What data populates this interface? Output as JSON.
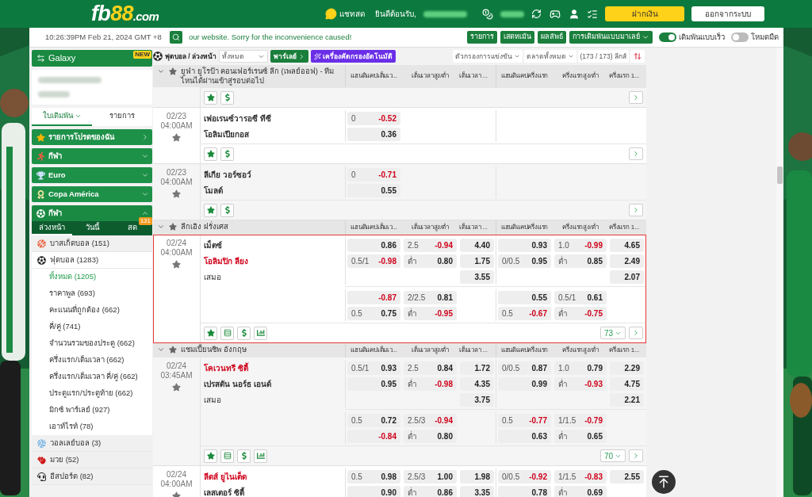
{
  "header": {
    "logo": {
      "brand": "fb",
      "digits": "88",
      "domain": ".com"
    },
    "chat": "แชทสด",
    "welcome": "ยินดีต้อนรับ,",
    "deposit": "ฝากเงิน",
    "logout": "ออกจากระบบ"
  },
  "topbar": {
    "clock": "10:26:39PM Feb 21, 2024 GMT +8",
    "marquee": "our website. Sorry for the inconvenience caused!",
    "buttons": [
      "รายการ",
      "เสตทเม้น",
      "ผลลัพธ์"
    ],
    "odds_type": "การเดิมพันแบบมาเลย์",
    "toggles": [
      {
        "label": "เดิมพันแบบเร็ว",
        "on": true
      },
      {
        "label": "โหมดมืด",
        "on": false
      }
    ]
  },
  "sidebar": {
    "banner": {
      "label": "Galaxy",
      "ribbon": "NEW"
    },
    "tabs": [
      {
        "label": "ใบเดิมพัน",
        "selected": true
      },
      {
        "label": "รายการ",
        "selected": false
      }
    ],
    "sections": [
      {
        "label": "รายการโปรดของฉัน",
        "kind": "link"
      },
      {
        "label": "กีฬา",
        "kind": "accordion",
        "expanded": false
      },
      {
        "label": "Euro",
        "kind": "accordion",
        "expanded": false
      },
      {
        "label": "Copa América",
        "kind": "accordion",
        "expanded": false
      },
      {
        "label": "กีฬา",
        "kind": "accordion",
        "expanded": true
      }
    ],
    "sport_tabs": [
      {
        "label": "ล่วงหน้า",
        "selected": true
      },
      {
        "label": "วันนี้",
        "selected": false
      },
      {
        "label": "สด",
        "selected": false,
        "badge": "131"
      }
    ],
    "sports": [
      {
        "label": "บาสเก็ตบอล (151)",
        "expanded": false
      },
      {
        "label": "ฟุตบอล (1283)",
        "expanded": true,
        "children": [
          {
            "label": "ทั้งหมด (1205)",
            "selected": true
          },
          {
            "label": "ราคาพูล (693)",
            "selected": false
          },
          {
            "label": "คะแนนที่ถูกต้อง (662)",
            "selected": false
          },
          {
            "label": "คี่/คู่ (741)",
            "selected": false
          },
          {
            "label": "จำนวนรวมของประตู (662)",
            "selected": false
          },
          {
            "label": "ครึ่งแรก/เต็มเวลา (662)",
            "selected": false
          },
          {
            "label": "ครึ่งแรก/เต็มเวลา คี่/คู่ (662)",
            "selected": false
          },
          {
            "label": "ประตูแรก/ประตูท้าย (662)",
            "selected": false
          },
          {
            "label": "มิกซ์ พาร์เลย์ (927)",
            "selected": false
          },
          {
            "label": "เอาท์ไรท์ (78)",
            "selected": false
          }
        ]
      },
      {
        "label": "วอลเลย์บอล (3)",
        "expanded": false
      },
      {
        "label": "มวย (52)",
        "expanded": false
      },
      {
        "label": "อีสปอร์ต (82)",
        "expanded": false
      }
    ]
  },
  "toolbar": {
    "title": "ฟุตบอล / ล่วงหน้า",
    "filter": "ทั้งหมด",
    "parlay": "พาร์เลย์",
    "auto_filter": "เครื่องคัดกรองอัตโนมัติ",
    "dropdowns": [
      "ตัวกรองการแข่งขัน",
      "ตลาดทั้งหมด"
    ],
    "league_count": "(173 / 173) ลีกส์"
  },
  "leagues": [
    {
      "name": "ยูฟ่า ยูโรป้า คอนเฟอร์เรนซ์ ลีก (เพลย์ออฟ) - ทีมไหนได้ผ่านเข้าสู่รอบต่อไป",
      "expanded": true,
      "columns": [
        "แฮนดิแคปเต็มเว...",
        "เต็มเวลาสูง/ต่ำ",
        "เต็มเวลา ...",
        "แฮนดิแคปครึ่งแรก",
        "ครึ่งแรกสูง/ต่ำ",
        "ครึ่งแรก 1..."
      ],
      "matches": [
        {
          "kind": "basic",
          "shaded": true,
          "highlighted": false
        },
        {
          "kind": "basic",
          "date": "02/23",
          "time": "04:00AM",
          "starred": false,
          "shaded": false,
          "highlighted": false,
          "teams": [
            {
              "name": "เฟอเรนซ์วารอซี ทีซี",
              "kind": "team",
              "favorite": false
            },
            {
              "name": "โอลิมเปียกอส",
              "kind": "team",
              "favorite": false
            }
          ],
          "lines": [
            {
              "ft_handicap": {
                "line": "0",
                "price": "-0.52",
                "negative": true
              }
            },
            {
              "ft_handicap": {
                "price": "0.36",
                "negative": false
              }
            }
          ]
        },
        {
          "kind": "basic",
          "date": "02/23",
          "time": "04:00AM",
          "starred": false,
          "shaded": true,
          "highlighted": false,
          "teams": [
            {
              "name": "ลีเกีย วอร์ซอว์",
              "kind": "team",
              "favorite": false
            },
            {
              "name": "โมลด์",
              "kind": "team",
              "favorite": false
            }
          ],
          "lines": [
            {
              "ft_handicap": {
                "line": "0",
                "price": "-0.71",
                "negative": true
              }
            },
            {
              "ft_handicap": {
                "price": "0.55",
                "negative": false
              }
            }
          ]
        }
      ]
    },
    {
      "name": "ลีกเอิง ฝรั่งเศส",
      "expanded": true,
      "columns": [
        "แฮนดิแคปเต็มเว...",
        "เต็มเวลาสูง/ต่ำ",
        "เต็มเวลา ...",
        "แฮนดิแคปครึ่งแรก",
        "ครึ่งแรกสูง/ต่ำ",
        "ครึ่งแรก 1..."
      ],
      "matches": [
        {
          "kind": "full",
          "date": "02/24",
          "time": "04:00AM",
          "starred": false,
          "shaded": false,
          "highlighted": true,
          "teams": [
            {
              "name": "เม็ตซ์",
              "kind": "team",
              "favorite": false
            },
            {
              "name": "โอลิมปิก ลียง",
              "kind": "team",
              "favorite": true
            },
            {
              "name": "เสมอ",
              "kind": "draw"
            }
          ],
          "lines": [
            {
              "ft_handicap": {
                "price": "0.86",
                "negative": false
              },
              "ft_over_under": {
                "line": "2.5",
                "price": "-0.94",
                "negative": true
              },
              "ft_1x2": {
                "price": "4.40",
                "negative": false
              },
              "h1_handicap": {
                "price": "0.93",
                "negative": false
              },
              "h1_over_under": {
                "line": "1.0",
                "price": "-0.99",
                "negative": true
              },
              "h1_1x2": {
                "price": "4.65",
                "negative": false
              }
            },
            {
              "ft_handicap": {
                "line": "0.5/1",
                "price": "-0.98",
                "negative": true
              },
              "ft_over_under": {
                "line": "ต่ำ",
                "price": "0.80",
                "negative": false
              },
              "ft_1x2": {
                "price": "1.75",
                "negative": false
              },
              "h1_handicap": {
                "line": "0/0.5",
                "price": "0.95",
                "negative": false
              },
              "h1_over_under": {
                "line": "ต่ำ",
                "price": "0.85",
                "negative": false
              },
              "h1_1x2": {
                "price": "2.49",
                "negative": false
              }
            },
            {
              "ft_1x2": {
                "price": "3.55",
                "negative": false
              },
              "h1_1x2": {
                "price": "2.07",
                "negative": false
              }
            }
          ],
          "extra": [
            {
              "ft_handicap": {
                "price": "-0.87",
                "negative": true
              },
              "ft_over_under": {
                "line": "2/2.5",
                "price": "0.81",
                "negative": false
              },
              "h1_handicap": {
                "price": "0.55",
                "negative": false
              },
              "h1_over_under": {
                "line": "0.5/1",
                "price": "0.61",
                "negative": false
              }
            },
            {
              "ft_handicap": {
                "line": "0.5",
                "price": "0.75",
                "negative": false
              },
              "ft_over_under": {
                "line": "ต่ำ",
                "price": "-0.95",
                "negative": true
              },
              "h1_handicap": {
                "line": "0.5",
                "price": "-0.67",
                "negative": true
              },
              "h1_over_under": {
                "line": "ต่ำ",
                "price": "-0.75",
                "negative": true
              }
            }
          ],
          "more": "73"
        }
      ]
    },
    {
      "name": "แชมเปี้ยนชิพ อังกฤษ",
      "expanded": true,
      "columns": [
        "แฮนดิแคปเต็มเว...",
        "เต็มเวลาสูง/ต่ำ",
        "เต็มเวลา ...",
        "แฮนดิแคปครึ่งแรก",
        "ครึ่งแรกสูง/ต่ำ",
        "ครึ่งแรก 1..."
      ],
      "matches": [
        {
          "kind": "full",
          "date": "02/24",
          "time": "03:45AM",
          "starred": false,
          "shaded": true,
          "highlighted": false,
          "teams": [
            {
              "name": "โคเวนทรี ซิตี้",
              "kind": "team",
              "favorite": true
            },
            {
              "name": "เปรสตัน นอร์ธ เอนด์",
              "kind": "team",
              "favorite": false
            },
            {
              "name": "เสมอ",
              "kind": "draw"
            }
          ],
          "lines": [
            {
              "ft_handicap": {
                "line": "0.5/1",
                "price": "0.93",
                "negative": false
              },
              "ft_over_under": {
                "line": "2.5",
                "price": "0.84",
                "negative": false
              },
              "ft_1x2": {
                "price": "1.72",
                "negative": false
              },
              "h1_handicap": {
                "line": "0/0.5",
                "price": "0.87",
                "negative": false
              },
              "h1_over_under": {
                "line": "1.0",
                "price": "0.79",
                "negative": false
              },
              "h1_1x2": {
                "price": "2.29",
                "negative": false
              }
            },
            {
              "ft_handicap": {
                "price": "0.95",
                "negative": false
              },
              "ft_over_under": {
                "line": "ต่ำ",
                "price": "-0.98",
                "negative": true
              },
              "ft_1x2": {
                "price": "4.35",
                "negative": false
              },
              "h1_handicap": {
                "price": "0.99",
                "negative": false
              },
              "h1_over_under": {
                "line": "ต่ำ",
                "price": "-0.93",
                "negative": true
              },
              "h1_1x2": {
                "price": "4.75",
                "negative": false
              }
            },
            {
              "ft_1x2": {
                "price": "3.75",
                "negative": false
              },
              "h1_1x2": {
                "price": "2.21",
                "negative": false
              }
            }
          ],
          "extra": [
            {
              "ft_handicap": {
                "line": "0.5",
                "price": "0.72",
                "negative": false
              },
              "ft_over_under": {
                "line": "2.5/3",
                "price": "-0.94",
                "negative": true
              },
              "h1_handicap": {
                "line": "0.5",
                "price": "-0.77",
                "negative": true
              },
              "h1_over_under": {
                "line": "1/1.5",
                "price": "-0.79",
                "negative": true
              }
            },
            {
              "ft_handicap": {
                "price": "-0.84",
                "negative": true
              },
              "ft_over_under": {
                "line": "ต่ำ",
                "price": "0.80",
                "negative": false
              },
              "h1_handicap": {
                "price": "0.63",
                "negative": false
              },
              "h1_over_under": {
                "line": "ต่ำ",
                "price": "0.65",
                "negative": false
              }
            }
          ],
          "more": "70"
        },
        {
          "kind": "open",
          "date": "02/24",
          "time": "04:00AM",
          "starred": false,
          "shaded": false,
          "highlighted": false,
          "teams": [
            {
              "name": "ลีดส์ ยูไนเต็ด",
              "kind": "team",
              "favorite": true
            },
            {
              "name": "เลสเตอร์ ซิตี้",
              "kind": "team",
              "favorite": false
            }
          ],
          "lines": [
            {
              "ft_handicap": {
                "line": "0.5",
                "price": "0.98",
                "negative": false
              },
              "ft_over_under": {
                "line": "2.5/3",
                "price": "1.00",
                "negative": false
              },
              "ft_1x2": {
                "price": "1.98",
                "negative": false
              },
              "h1_handicap": {
                "line": "0/0.5",
                "price": "-0.92",
                "negative": true
              },
              "h1_over_under": {
                "line": "1/1.5",
                "price": "-0.83",
                "negative": true
              },
              "h1_1x2": {
                "price": "2.55",
                "negative": false
              }
            },
            {
              "ft_handicap": {
                "price": "0.90",
                "negative": false
              },
              "ft_over_under": {
                "line": "ต่ำ",
                "price": "0.86",
                "negative": false
              },
              "ft_1x2": {
                "price": "3.35",
                "negative": false
              },
              "h1_handicap": {
                "price": "0.78",
                "negative": false
              },
              "h1_over_under": {
                "line": "ต่ำ",
                "price": "0.69",
                "negative": false
              }
            }
          ]
        }
      ]
    }
  ]
}
